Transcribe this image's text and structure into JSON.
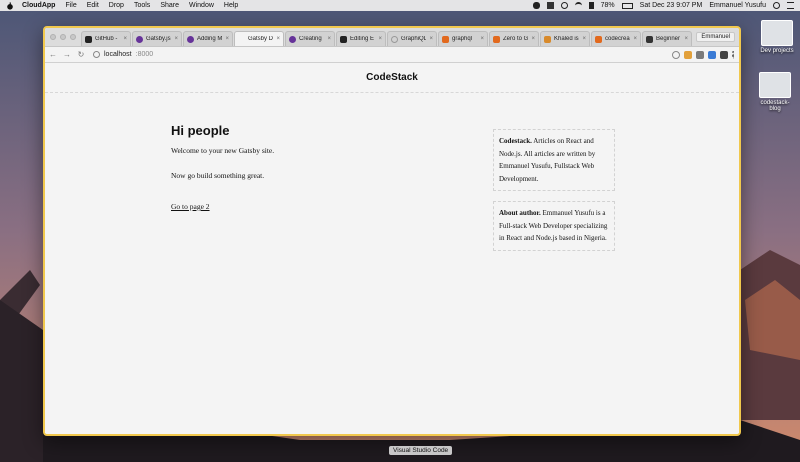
{
  "menubar": {
    "app_name": "CloudApp",
    "menus": [
      "File",
      "Edit",
      "Drop",
      "Tools",
      "Share",
      "Window",
      "Help"
    ],
    "battery": "78%",
    "datetime": "Sat Dec 23  9:07 PM",
    "user": "Emmanuel Yusufu"
  },
  "browser": {
    "tabs": [
      {
        "label": "GitHub -",
        "color": "#222222",
        "active": false
      },
      {
        "label": "Gatsby.js",
        "color": "#663399",
        "active": false
      },
      {
        "label": "Adding M",
        "color": "#663399",
        "active": false
      },
      {
        "label": "Gatsby D",
        "color": "#f3f3f3",
        "active": true
      },
      {
        "label": "Creating",
        "color": "#663399",
        "active": false
      },
      {
        "label": "Editing E",
        "color": "#222222",
        "active": false
      },
      {
        "label": "GraphiQL",
        "color": "#999999",
        "active": false
      },
      {
        "label": "graphql",
        "color": "#e2691d",
        "active": false
      },
      {
        "label": "Zero to G",
        "color": "#e2691d",
        "active": false
      },
      {
        "label": "Khaled is",
        "color": "#d88a2b",
        "active": false
      },
      {
        "label": "codecrea",
        "color": "#e2691d",
        "active": false
      },
      {
        "label": "Beginner",
        "color": "#333333",
        "active": false
      }
    ],
    "profile_name": "Emmanuel",
    "url_host": "localhost",
    "url_port": ":8000"
  },
  "site": {
    "title": "CodeStack",
    "heading": "Hi people",
    "welcome": "Welcome to your new Gatsby site.",
    "build": "Now go build something great.",
    "link": "Go to page 2",
    "sidebar": [
      {
        "title": "Codestack.",
        "text": " Articles on React and Node.js. All articles are written by Emmanuel Yusufu, Fullstack Web Development."
      },
      {
        "title": "About author.",
        "text": " Emmanuel Yusufu is a Full-stack Web Developer specializing in React and Node.js based in Nigeria."
      }
    ]
  },
  "desktop": {
    "folders": [
      "Dev projects",
      "codestack-blog"
    ],
    "dock_tooltip": "Visual Studio Code"
  }
}
